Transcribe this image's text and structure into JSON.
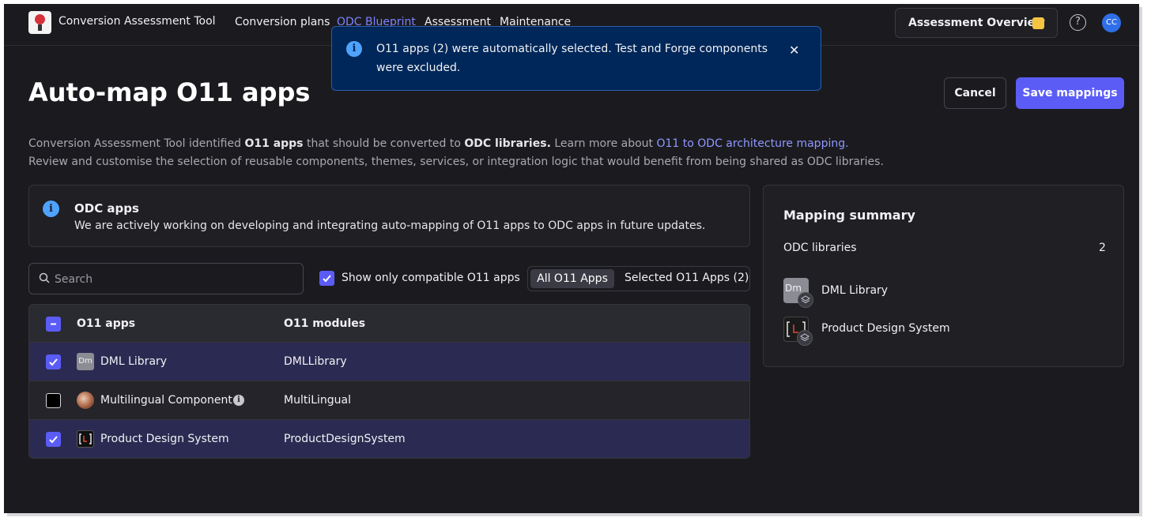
{
  "topbar": {
    "app_title": "Conversion Assessment Tool",
    "nav": [
      "Conversion plans",
      "ODC Blueprint",
      "Assessment",
      "Maintenance"
    ],
    "active_nav": "ODC Blueprint",
    "overview_label": "Assessment Overview",
    "help_glyph": "?",
    "avatar_initials": "CC"
  },
  "toast": {
    "icon": "info-icon",
    "message": "O11 apps (2) were automatically selected. Test and Forge components were excluded.",
    "close_glyph": "✕"
  },
  "header": {
    "title": "Auto-map O11 apps",
    "cancel_label": "Cancel",
    "save_label": "Save mappings"
  },
  "description": {
    "p1_a": "Conversion Assessment Tool identified ",
    "p1_b": "O11 apps",
    "p1_c": " that should be converted to ",
    "p1_d": "ODC libraries.",
    "p1_e": " Learn more about ",
    "p1_link": "O11 to ODC architecture mapping.",
    "p2": "Review and customise the selection of reusable components, themes, services, or integration logic that would benefit from being shared as ODC libraries."
  },
  "info_card": {
    "heading": "ODC apps",
    "text": "We are actively working on developing and integrating auto-mapping of O11 apps to ODC apps in future updates."
  },
  "controls": {
    "search_placeholder": "Search",
    "compat_label": "Show only compatible O11 apps",
    "compat_checked": true,
    "seg_all": "All O11 Apps",
    "seg_selected": "Selected O11 Apps (2)",
    "seg_active": "All O11 Apps"
  },
  "table": {
    "col_apps": "O11 apps",
    "col_modules": "O11 modules",
    "rows": [
      {
        "app": "DML Library",
        "module": "DMLLibrary",
        "selected": true,
        "icon": "dm-icon",
        "icon_text": "Dm"
      },
      {
        "app": "Multilingual Component",
        "module": "MultiLingual",
        "selected": false,
        "icon": "multilingual-icon",
        "has_info": true
      },
      {
        "app": "Product Design System",
        "module": "ProductDesignSystem",
        "selected": true,
        "icon": "pds-icon"
      }
    ]
  },
  "summary": {
    "heading": "Mapping summary",
    "libraries_label": "ODC libraries",
    "libraries_count": "2",
    "libraries": [
      {
        "name": "DML Library",
        "icon_text": "Dm"
      },
      {
        "name": "Product Design System"
      }
    ]
  },
  "colors": {
    "accent": "#5b5cf6",
    "toast_bg": "#002759",
    "info": "#4fa3ff",
    "selected_row": "#2b2a52",
    "link": "#8f97ff",
    "badge": "#f5c542"
  }
}
